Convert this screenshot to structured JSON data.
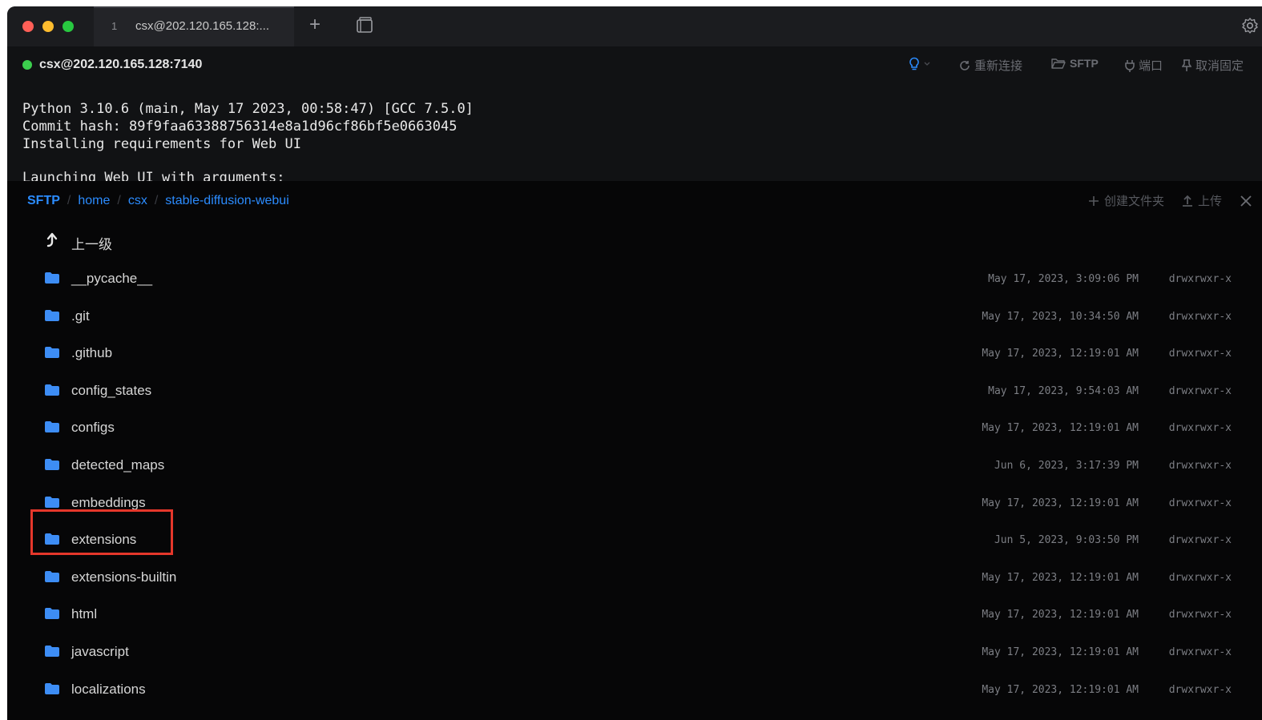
{
  "tab": {
    "number": "1",
    "label": "csx@202.120.165.128:..."
  },
  "new_tab_glyph": "+",
  "session": {
    "title": "csx@202.120.165.128:7140",
    "status_color": "#3ccf4e",
    "buttons": {
      "reconnect": "重新连接",
      "sftp": "SFTP",
      "ports": "端口",
      "unpin": "取消固定"
    }
  },
  "terminal": {
    "lines": [
      "Python 3.10.6 (main, May 17 2023, 00:58:47) [GCC 7.5.0]",
      "Commit hash: 89f9faa63388756314e8a1d96cf86bf5e0663045",
      "Installing requirements for Web UI",
      "",
      "Launching Web UI with arguments:"
    ]
  },
  "sftp": {
    "breadcrumb": {
      "root": "SFTP",
      "parts": [
        "home",
        "csx",
        "stable-diffusion-webui"
      ],
      "separator": "/"
    },
    "actions": {
      "new_folder": "创建文件夹",
      "upload": "上传"
    },
    "up_label": "上一级",
    "accent_color": "#2b8cff",
    "highlight_color": "#e5372b",
    "files": [
      {
        "name": "__pycache__",
        "date": "May 17, 2023, 3:09:06 PM",
        "perm": "drwxrwxr-x"
      },
      {
        "name": ".git",
        "date": "May 17, 2023, 10:34:50 AM",
        "perm": "drwxrwxr-x"
      },
      {
        "name": ".github",
        "date": "May 17, 2023, 12:19:01 AM",
        "perm": "drwxrwxr-x"
      },
      {
        "name": "config_states",
        "date": "May 17, 2023, 9:54:03 AM",
        "perm": "drwxrwxr-x"
      },
      {
        "name": "configs",
        "date": "May 17, 2023, 12:19:01 AM",
        "perm": "drwxrwxr-x"
      },
      {
        "name": "detected_maps",
        "date": "Jun 6, 2023, 3:17:39 PM",
        "perm": "drwxrwxr-x"
      },
      {
        "name": "embeddings",
        "date": "May 17, 2023, 12:19:01 AM",
        "perm": "drwxrwxr-x"
      },
      {
        "name": "extensions",
        "date": "Jun 5, 2023, 9:03:50 PM",
        "perm": "drwxrwxr-x",
        "highlighted": true
      },
      {
        "name": "extensions-builtin",
        "date": "May 17, 2023, 12:19:01 AM",
        "perm": "drwxrwxr-x"
      },
      {
        "name": "html",
        "date": "May 17, 2023, 12:19:01 AM",
        "perm": "drwxrwxr-x"
      },
      {
        "name": "javascript",
        "date": "May 17, 2023, 12:19:01 AM",
        "perm": "drwxrwxr-x"
      },
      {
        "name": "localizations",
        "date": "May 17, 2023, 12:19:01 AM",
        "perm": "drwxrwxr-x"
      }
    ]
  }
}
